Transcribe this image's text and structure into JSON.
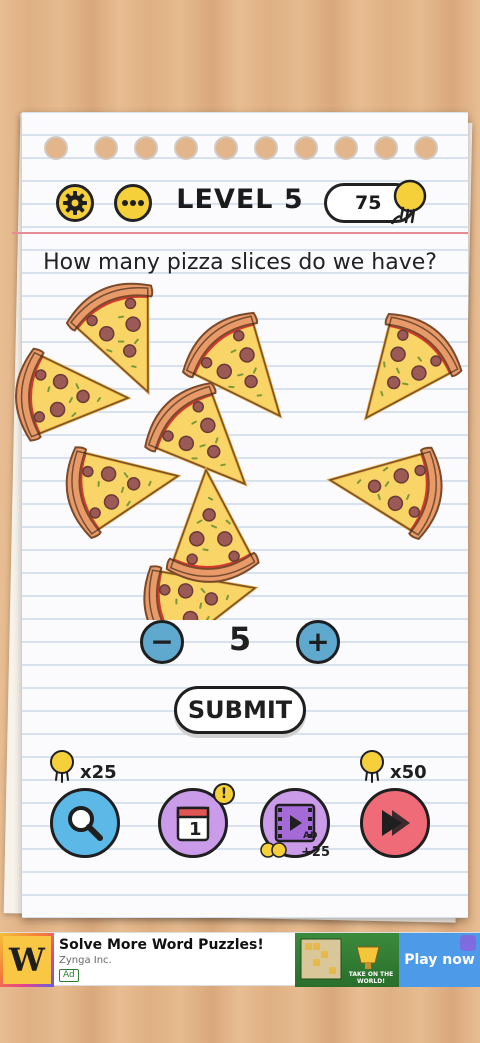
{
  "header": {
    "level_title": "LEVEL 5",
    "hints_count": "75",
    "settings_icon": "gear-icon",
    "more_icon": "ellipsis-icon",
    "hint_icon": "lightbulb-icon"
  },
  "puzzle": {
    "question": "How many pizza slices do we have?",
    "answer_value": "5",
    "minus_label": "−",
    "plus_label": "+",
    "submit_label": "SUBMIT"
  },
  "tools": {
    "search_cost": "x25",
    "skip_cost": "x50",
    "ad_reward": "+25",
    "calendar_day": "1",
    "ad_label": "AD",
    "search_icon": "magnifier-icon",
    "calendar_icon": "calendar-icon",
    "video_icon": "film-play-icon",
    "skip_icon": "fast-forward-icon"
  },
  "ad": {
    "title": "Solve More Word Puzzles!",
    "publisher": "Zynga Inc.",
    "tag": "Ad",
    "logo_letter": "W",
    "cta": "Play now",
    "image_caption": "TAKE ON THE WORLD!"
  },
  "colors": {
    "accent_yellow": "#f5d03a",
    "stepper_blue": "#5fa9cf",
    "tool_blue": "#5cb8e6",
    "tool_purple": "#c99be8",
    "tool_pink": "#ee6b77",
    "cta_blue": "#4c9ae8"
  }
}
